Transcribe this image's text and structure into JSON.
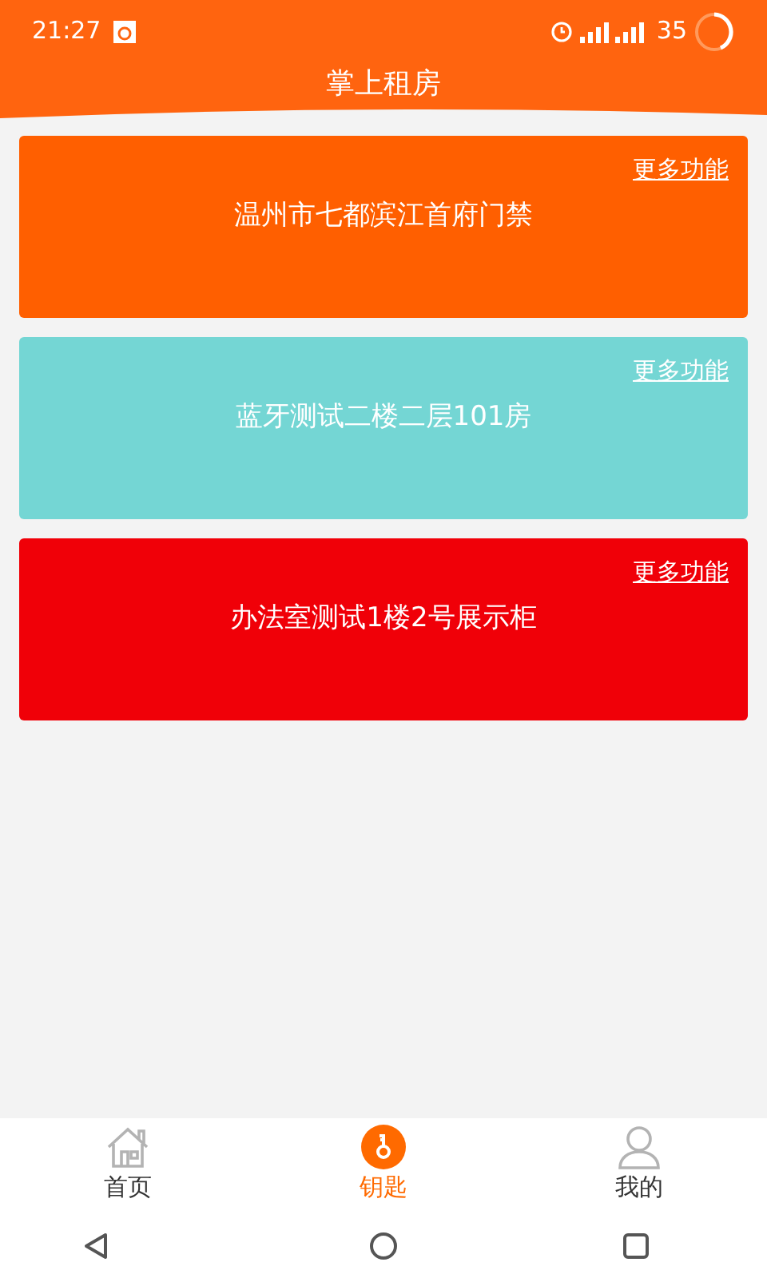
{
  "status_bar": {
    "time": "21:27",
    "battery": "35"
  },
  "header": {
    "title": "掌上租房"
  },
  "cards": [
    {
      "name": "温州市七都滨江首府门禁",
      "more": "更多功能",
      "color": "#ff5f00"
    },
    {
      "name": "蓝牙测试二楼二层101房",
      "more": "更多功能",
      "color": "#74d6d4"
    },
    {
      "name": "办法室测试1楼2号展示柜",
      "more": "更多功能",
      "color": "#f00008"
    }
  ],
  "tabs": [
    {
      "label": "首页",
      "kind": "home",
      "selected": false
    },
    {
      "label": "钥匙",
      "kind": "key",
      "selected": true
    },
    {
      "label": "我的",
      "kind": "user",
      "selected": false
    }
  ]
}
